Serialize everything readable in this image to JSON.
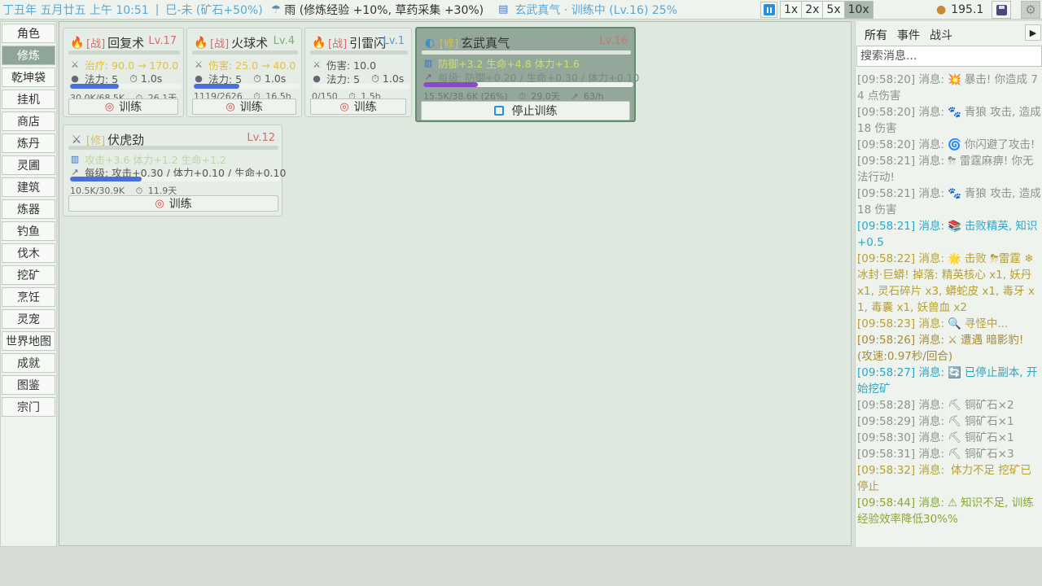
{
  "topbar": {
    "game_time": "丁丑年 五月廿五 上午 10:51",
    "separator": "|",
    "era": "巳-未 (矿石+50%)",
    "weather": "雨 (修炼经验 +10%, 草药采集 +30%)",
    "training_status": "玄武真气 · 训练中 (Lv.16) 25%",
    "speeds": [
      "1x",
      "2x",
      "5x",
      "10x"
    ],
    "active_speed": "10x",
    "coins": "195.1",
    "icons": {
      "weather": "rain-cloud-icon",
      "book": "book-icon",
      "pause": "pause-icon",
      "coins": "money-bag-icon",
      "save": "floppy-disk-icon",
      "settings": "gear-icon"
    }
  },
  "sidebar": {
    "items": [
      "角色",
      "修炼",
      "乾坤袋",
      "挂机",
      "商店",
      "炼丹",
      "灵圃",
      "建筑",
      "炼器",
      "钓鱼",
      "伐木",
      "挖矿",
      "烹饪",
      "灵宠",
      "世界地图",
      "成就",
      "图鉴",
      "宗门"
    ],
    "active": "修炼"
  },
  "skills": [
    {
      "tag": "[战]",
      "name": "回复术",
      "level": "Lv.17",
      "line1": "治疗: 90.0 → 170.0",
      "cost": "法力: 5",
      "time": "1.0s",
      "progress_text": "30.0K/68.5K",
      "eta": "26.1天",
      "progress": 0.44,
      "button": "训练"
    },
    {
      "tag": "[战]",
      "name": "火球术",
      "level": "Lv.4",
      "line1": "伤害: 25.0 → 40.0",
      "cost": "法力: 5",
      "time": "1.0s",
      "progress_text": "1119/2626",
      "eta": "16.5h",
      "progress": 0.43,
      "button": "训练"
    },
    {
      "tag": "[战]",
      "name": "引雷闪",
      "level": "Lv.1",
      "line1": "伤害: 10.0",
      "cost": "法力: 5",
      "time": "1.0s",
      "progress_text": "0/150",
      "eta": "1.5h",
      "progress": 0,
      "button": "训练"
    },
    {
      "tag": "[修]",
      "name": "玄武真气",
      "level": "Lv.16",
      "stats": "防御+3.2  生命+4.8  体力+1.6",
      "per_level": "每级: 防御+0.20 / 生命+0.30 / 体力+0.10",
      "progress_text": "15.5K/38.6K (26%)",
      "eta": "29.0天",
      "rate": "63/h",
      "progress": 0.26,
      "button": "停止训练"
    },
    {
      "tag": "[修]",
      "name": "伏虎劲",
      "level": "Lv.12",
      "stats": "攻击+3.6  体力+1.2  生命+1.2",
      "per_level": "每级: 攻击+0.30 / 体力+0.10 / 生命+0.10",
      "progress_text": "10.5K/30.9K",
      "eta": "11.9天",
      "progress": 0.34,
      "button": "训练"
    }
  ],
  "log": {
    "tabs": [
      "所有",
      "事件",
      "战斗"
    ],
    "active_tab": "所有",
    "search_placeholder": "搜索消息...",
    "entries": [
      {
        "time": "[09:58:20]",
        "prefix": "消息:",
        "icon": "💥",
        "text": "暴击! 你造成 74 点伤害",
        "color": "gray"
      },
      {
        "time": "[09:58:20]",
        "prefix": "消息:",
        "icon": "🐾",
        "text": "青狼 攻击, 造成 18 伤害",
        "color": "gray"
      },
      {
        "time": "[09:58:20]",
        "prefix": "消息:",
        "icon": "🌀",
        "text": "你闪避了攻击!",
        "color": "gray"
      },
      {
        "time": "[09:58:21]",
        "prefix": "消息:",
        "icon": "⛈",
        "text": "雷霆麻痹! 你无法行动!",
        "color": "gray"
      },
      {
        "time": "[09:58:21]",
        "prefix": "消息:",
        "icon": "🐾",
        "text": "青狼 攻击, 造成 18 伤害",
        "color": "gray"
      },
      {
        "time": "[09:58:21]",
        "prefix": "消息:",
        "icon": "📚",
        "text": "击败精英, 知识 +0.5",
        "color": "cyan"
      },
      {
        "time": "[09:58:22]",
        "prefix": "消息:",
        "icon": "🌟",
        "text": "击败 ⛈雷霆 ❄冰封·巨蟒! 掉落: 精英核心 x1, 妖丹 x1, 灵石碎片 x3, 蟒蛇皮 x1, 毒牙 x1, 毒囊 x1, 妖兽血 x2",
        "color": "olive"
      },
      {
        "time": "[09:58:23]",
        "prefix": "消息:",
        "icon": "🔍",
        "text": "寻怪中...",
        "color": "olive"
      },
      {
        "time": "[09:58:26]",
        "prefix": "消息:",
        "icon": "⚔",
        "text": "遭遇 暗影豹! (攻速:0.97秒/回合)",
        "color": "brown"
      },
      {
        "time": "[09:58:27]",
        "prefix": "消息:",
        "icon": "🔄",
        "text": "已停止副本, 开始挖矿",
        "color": "cyan"
      },
      {
        "time": "[09:58:28]",
        "prefix": "消息:",
        "icon": "⛏",
        "text": "铜矿石×2",
        "color": "gray"
      },
      {
        "time": "[09:58:29]",
        "prefix": "消息:",
        "icon": "⛏",
        "text": "铜矿石×1",
        "color": "gray"
      },
      {
        "time": "[09:58:30]",
        "prefix": "消息:",
        "icon": "⛏",
        "text": "铜矿石×1",
        "color": "gray"
      },
      {
        "time": "[09:58:31]",
        "prefix": "消息:",
        "icon": "⛏",
        "text": "铜矿石×3",
        "color": "gray"
      },
      {
        "time": "[09:58:32]",
        "prefix": "消息:",
        "icon": "",
        "text": "体力不足 挖矿已停止",
        "color": "olive"
      },
      {
        "time": "[09:58:44]",
        "prefix": "消息:",
        "icon": "⚠",
        "text": "知识不足, 训练经验效率降低30%%",
        "color": "green"
      }
    ]
  }
}
